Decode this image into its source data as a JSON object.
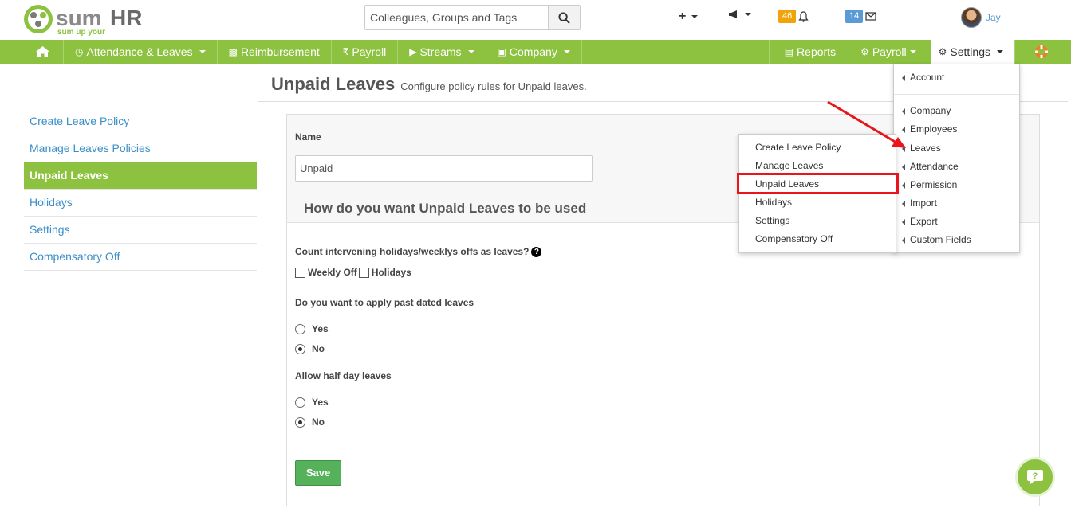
{
  "header": {
    "logo_text": "sumHR",
    "logo_tagline": "sum up your HR",
    "search_placeholder": "Colleagues, Groups and Tags",
    "notifications_count": "46",
    "messages_count": "14",
    "user_name": "Jay"
  },
  "navbar": {
    "items": [
      {
        "label": ""
      },
      {
        "label": "Attendance & Leaves"
      },
      {
        "label": "Reimbursement"
      },
      {
        "label": "Payroll"
      },
      {
        "label": "Streams"
      },
      {
        "label": "Company"
      }
    ],
    "right": [
      {
        "label": "Reports"
      },
      {
        "label": "Payroll"
      },
      {
        "label": "Settings"
      }
    ]
  },
  "sidebar": {
    "items": [
      {
        "label": "Create Leave Policy"
      },
      {
        "label": "Manage Leaves Policies"
      },
      {
        "label": "Unpaid Leaves"
      },
      {
        "label": "Holidays"
      },
      {
        "label": "Settings"
      },
      {
        "label": "Compensatory Off"
      }
    ]
  },
  "page": {
    "title": "Unpaid Leaves",
    "subtitle": "Configure policy rules for Unpaid leaves."
  },
  "form": {
    "name_label": "Name",
    "name_value": "Unpaid",
    "section_heading": "How do you want Unpaid Leaves to be used",
    "q1": "Count intervening holidays/weeklys offs as leaves?",
    "cb_weekly": "Weekly Off",
    "cb_holidays": "Holidays",
    "q2": "Do you want to apply past dated leaves",
    "q2_yes": "Yes",
    "q2_no": "No",
    "q3": "Allow half day leaves",
    "q3_yes": "Yes",
    "q3_no": "No",
    "save_label": "Save"
  },
  "settings_menu": {
    "items": [
      {
        "label": "Account"
      },
      {
        "label": "Company"
      },
      {
        "label": "Employees"
      },
      {
        "label": "Leaves"
      },
      {
        "label": "Attendance"
      },
      {
        "label": "Permission"
      },
      {
        "label": "Import"
      },
      {
        "label": "Export"
      },
      {
        "label": "Custom Fields"
      }
    ]
  },
  "leaves_menu": {
    "items": [
      {
        "label": "Create Leave Policy"
      },
      {
        "label": "Manage Leaves"
      },
      {
        "label": "Unpaid Leaves"
      },
      {
        "label": "Holidays"
      },
      {
        "label": "Settings"
      },
      {
        "label": "Compensatory Off"
      }
    ]
  },
  "colors": {
    "brand_green": "#8cc23f",
    "link_blue": "#3a8fc7",
    "save_green": "#55b25a",
    "annotation_red": "#e8161b",
    "badge_orange": "#f0a30a",
    "badge_blue": "#5b9bd5"
  }
}
